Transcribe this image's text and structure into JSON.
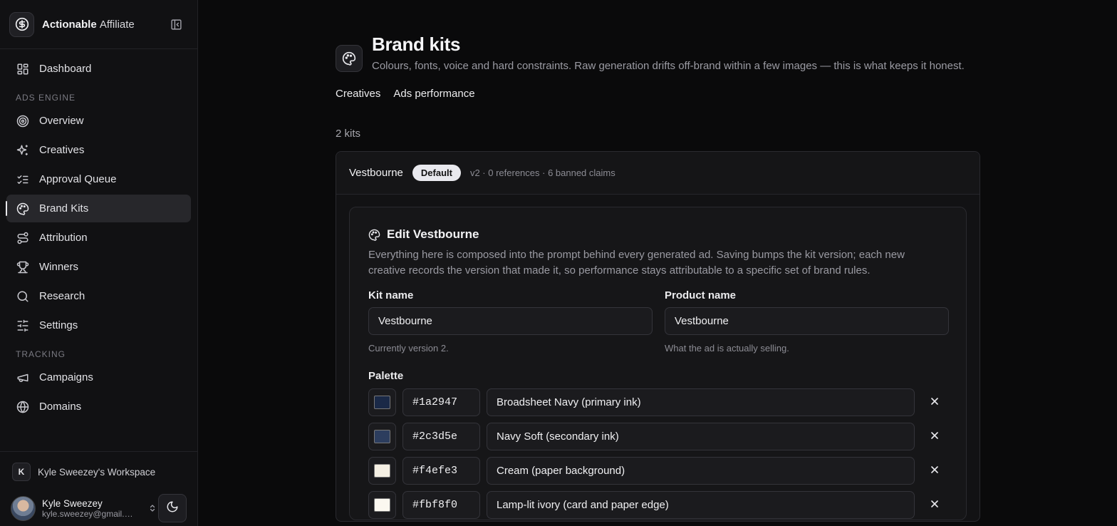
{
  "brand": {
    "name_bold": "Actionable",
    "name_light": "Affiliate"
  },
  "nav": {
    "dashboard": "Dashboard",
    "section_ads": "ADS ENGINE",
    "overview": "Overview",
    "creatives": "Creatives",
    "approval_queue": "Approval Queue",
    "brand_kits": "Brand Kits",
    "attribution": "Attribution",
    "winners": "Winners",
    "research": "Research",
    "settings": "Settings",
    "section_tracking": "TRACKING",
    "campaigns": "Campaigns",
    "domains": "Domains"
  },
  "footer": {
    "workspace_initial": "K",
    "workspace_name": "Kyle Sweezey's Workspace",
    "user_name": "Kyle Sweezey",
    "user_email": "kyle.sweezey@gmail.com"
  },
  "page": {
    "title": "Brand kits",
    "subtitle": "Colours, fonts, voice and hard constraints. Raw generation drifts off-brand within a few images — this is what keeps it honest.",
    "tabs": [
      "Creatives",
      "Ads performance"
    ],
    "kit_count": "2 kits"
  },
  "kit": {
    "name": "Vestbourne",
    "badge": "Default",
    "meta": "v2 · 0 references · 6 banned claims",
    "edit_title": "Edit Vestbourne",
    "edit_desc": "Everything here is composed into the prompt behind every generated ad. Saving bumps the kit version; each new creative records the version that made it, so performance stays attributable to a specific set of brand rules.",
    "kit_name_label": "Kit name",
    "kit_name_value": "Vestbourne",
    "kit_name_help": "Currently version 2.",
    "product_name_label": "Product name",
    "product_name_value": "Vestbourne",
    "product_name_help": "What the ad is actually selling.",
    "palette_label": "Palette",
    "palette": [
      {
        "hex": "#1a2947",
        "name": "Broadsheet Navy (primary ink)"
      },
      {
        "hex": "#2c3d5e",
        "name": "Navy Soft (secondary ink)"
      },
      {
        "hex": "#f4efe3",
        "name": "Cream (paper background)"
      },
      {
        "hex": "#fbf8f0",
        "name": "Lamp-lit ivory (card and paper edge)"
      }
    ]
  },
  "colors": {
    "accent": "#e9e9ee",
    "background": "#0a0a0b",
    "sidebar": "#111113"
  }
}
